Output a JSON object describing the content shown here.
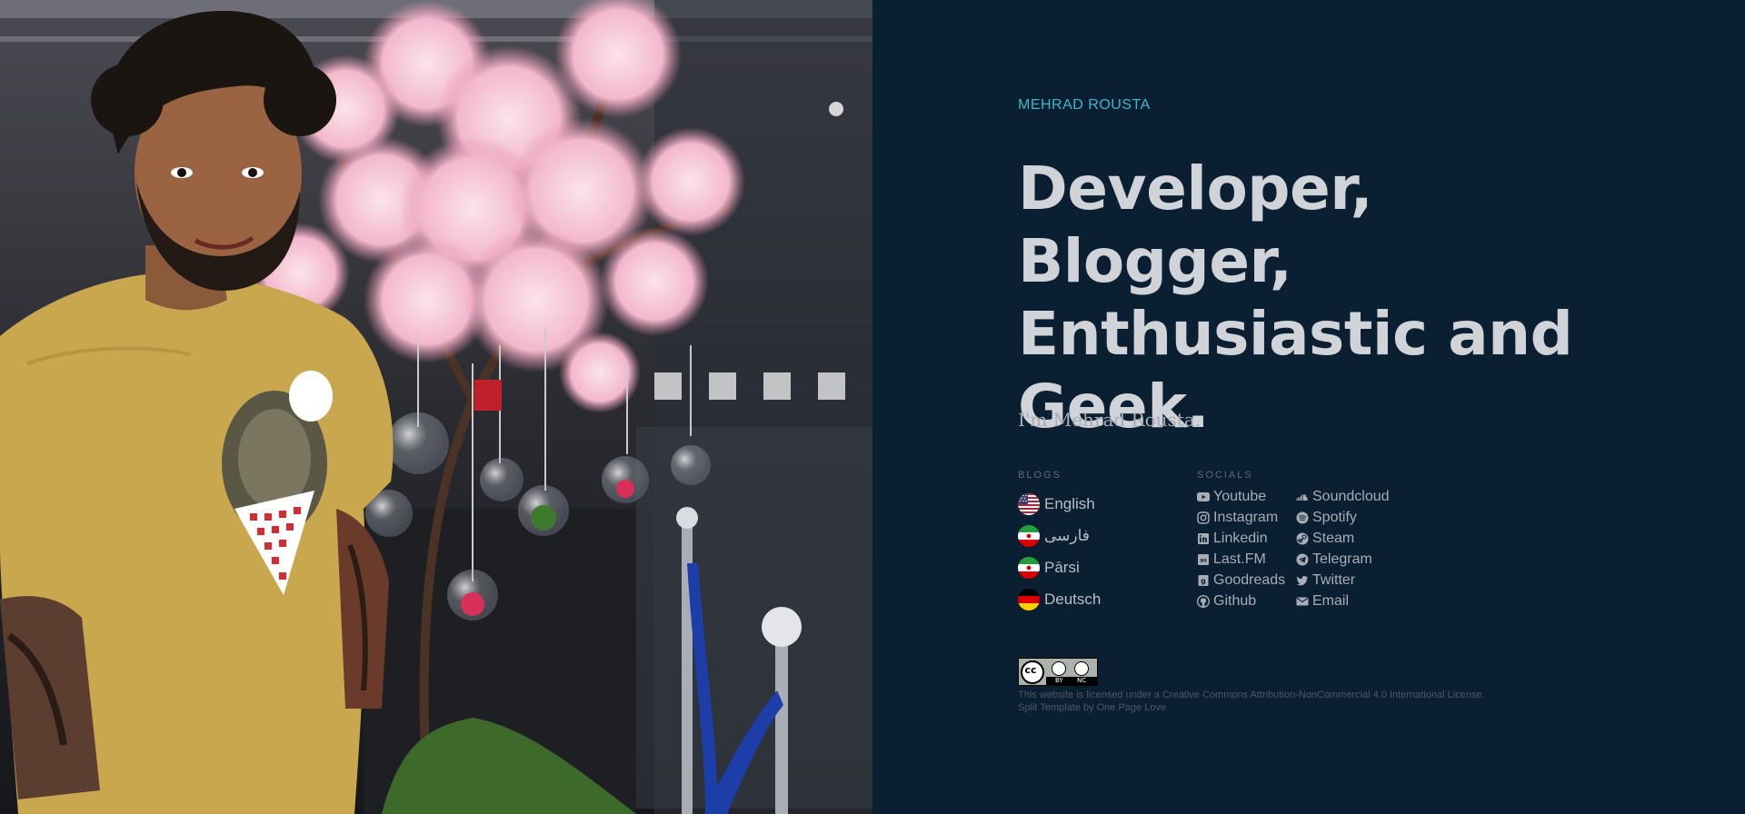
{
  "site": {
    "name": "MEHRAD ROUSTA"
  },
  "headline": "Developer, Blogger, Enthusiastic and Geek.",
  "intro": "I'm Mehrad Rousta.",
  "blogs": {
    "label": "BLOGS",
    "items": [
      {
        "label": "English",
        "flag": "us-flag-icon"
      },
      {
        "label": "فارسی",
        "flag": "iran-flag-icon"
      },
      {
        "label": "Pārsi",
        "flag": "iran-flag-icon"
      },
      {
        "label": "Deutsch",
        "flag": "germany-flag-icon"
      }
    ]
  },
  "socials": {
    "label": "SOCIALS",
    "items": [
      {
        "label": "Youtube",
        "icon": "youtube-icon"
      },
      {
        "label": "Soundcloud",
        "icon": "soundcloud-icon"
      },
      {
        "label": "Instagram",
        "icon": "instagram-icon"
      },
      {
        "label": "Spotify",
        "icon": "spotify-icon"
      },
      {
        "label": "Linkedin",
        "icon": "linkedin-icon"
      },
      {
        "label": "Steam",
        "icon": "steam-icon"
      },
      {
        "label": "Last.FM",
        "icon": "lastfm-icon"
      },
      {
        "label": "Telegram",
        "icon": "telegram-icon"
      },
      {
        "label": "Goodreads",
        "icon": "goodreads-icon"
      },
      {
        "label": "Twitter",
        "icon": "twitter-icon"
      },
      {
        "label": "Github",
        "icon": "github-icon"
      },
      {
        "label": "Email",
        "icon": "envelope-icon"
      }
    ]
  },
  "license": {
    "badge": {
      "cc": "cc",
      "by": "BY",
      "nc": "NC"
    },
    "text_prefix": "This website is licensed under a ",
    "link": "Creative Commons Attribution-NonCommercial 4.0 International License",
    "text_suffix": ".",
    "credit_prefix": "Split Template by ",
    "credit_link": "One Page Love"
  },
  "colors": {
    "background": "#0b1f33",
    "accent": "#3fb6c9",
    "headline": "#d0d3d8"
  }
}
